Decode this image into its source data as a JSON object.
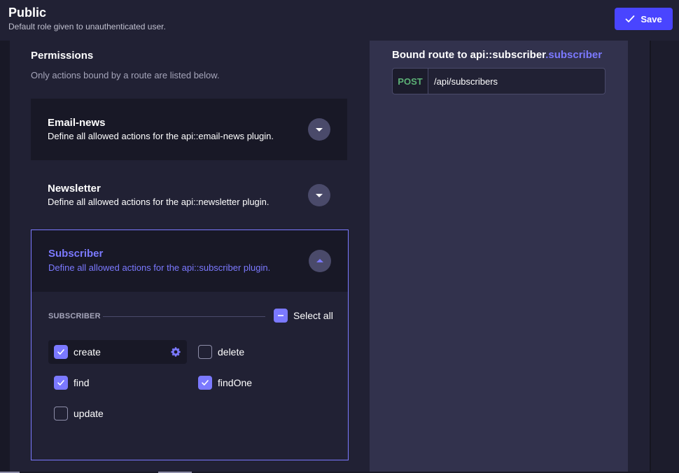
{
  "header": {
    "title": "Public",
    "subtitle": "Default role given to unauthenticated user.",
    "save_label": "Save"
  },
  "permissions": {
    "title": "Permissions",
    "subtitle": "Only actions bound by a route are listed below.",
    "accordions": [
      {
        "title": "Email-news",
        "description": "Define all allowed actions for the api::email-news plugin.",
        "expanded": false
      },
      {
        "title": "Newsletter",
        "description": "Define all allowed actions for the api::newsletter plugin.",
        "expanded": false
      },
      {
        "title": "Subscriber",
        "description": "Define all allowed actions for the api::subscriber plugin.",
        "expanded": true
      }
    ],
    "subscriber_section": {
      "label": "SUBSCRIBER",
      "select_all_label": "Select all",
      "select_all_state": "indeterminate",
      "actions": [
        {
          "label": "create",
          "checked": true,
          "active": true
        },
        {
          "label": "delete",
          "checked": false
        },
        {
          "label": "find",
          "checked": true
        },
        {
          "label": "findOne",
          "checked": true
        },
        {
          "label": "update",
          "checked": false
        }
      ]
    }
  },
  "bound_route": {
    "title_prefix": "Bound route to api::subscriber",
    "title_accent": ".subscriber",
    "method": "POST",
    "path": "/api/subscribers"
  },
  "colors": {
    "primary": "#4945ff",
    "accent": "#7b79ff",
    "method_post": "#5cb176"
  }
}
